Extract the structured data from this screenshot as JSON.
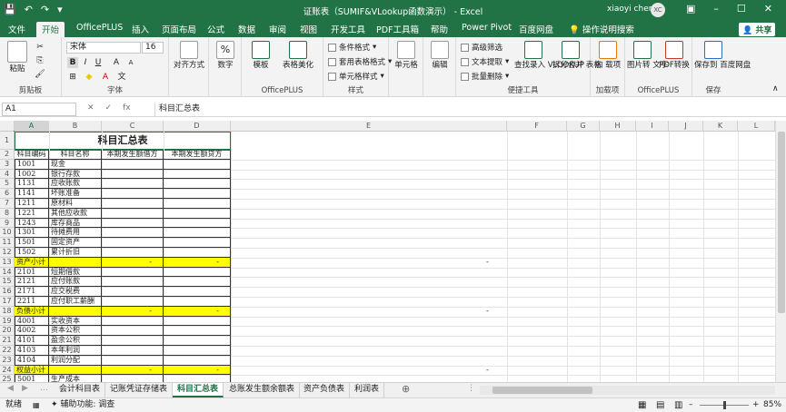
{
  "window": {
    "title": "证账表（SUMIF&VLookup函数演示） - Excel",
    "user": "xiaoyi chen",
    "avatar": "XC"
  },
  "ribbon_tabs": [
    "文件",
    "开始",
    "OfficePLUS",
    "插入",
    "页面布局",
    "公式",
    "数据",
    "审阅",
    "视图",
    "开发工具",
    "PDF工具箱",
    "帮助",
    "Power Pivot",
    "百度网盘",
    "操作说明搜索"
  ],
  "share_label": "共享",
  "ribbon": {
    "clipboard": {
      "paste": "粘贴",
      "group": "剪贴板"
    },
    "font": {
      "name": "宋体",
      "size": "16",
      "bold": "B",
      "italic": "I",
      "underline": "U",
      "group": "字体"
    },
    "align": {
      "label": "对齐方式"
    },
    "number": {
      "label": "数字",
      "percent": "%"
    },
    "officeplus1": {
      "template": "模板",
      "beautify": "表格美化",
      "group": "OfficePLUS"
    },
    "styles": {
      "cond": "条件格式",
      "table": "套用表格格式",
      "cell": "单元格样式",
      "group": "样式"
    },
    "cells": {
      "label": "单元格"
    },
    "edit": {
      "label": "编辑"
    },
    "quick": {
      "filter": "高级筛选",
      "text": "文本提取",
      "batch": "批量删除",
      "lookup": "查找录入 VLOOKUP",
      "split": "拆分合并 表格",
      "group": "便捷工具"
    },
    "load": {
      "label": "加 载项",
      "group": "加载项"
    },
    "officeplus2": {
      "img": "图片转 文字",
      "pdf": "PDF转换",
      "group": "OfficePLUS"
    },
    "save": {
      "label": "保存到 百度网盘",
      "group": "保存"
    }
  },
  "formula": {
    "namebox": "A1",
    "fx": "fx",
    "value": "科目汇总表"
  },
  "columns": [
    "A",
    "B",
    "C",
    "D",
    "E",
    "F",
    "G",
    "H",
    "I",
    "J",
    "K",
    "L"
  ],
  "sheet": {
    "title": "科目汇总表",
    "headers": [
      "科目编码",
      "科目名称",
      "本期发生额借方",
      "本期发生额贷方"
    ],
    "rows": [
      {
        "n": "3",
        "code": "1001",
        "name": "现金"
      },
      {
        "n": "4",
        "code": "1002",
        "name": "银行存款"
      },
      {
        "n": "5",
        "code": "1131",
        "name": "应收账款"
      },
      {
        "n": "6",
        "code": "1141",
        "name": "坏账准备"
      },
      {
        "n": "7",
        "code": "1211",
        "name": "原材料"
      },
      {
        "n": "8",
        "code": "1221",
        "name": "其他应收款"
      },
      {
        "n": "9",
        "code": "1243",
        "name": "库存商品"
      },
      {
        "n": "10",
        "code": "1301",
        "name": "待摊费用"
      },
      {
        "n": "11",
        "code": "1501",
        "name": "固定资产"
      },
      {
        "n": "12",
        "code": "1502",
        "name": "累计折旧"
      },
      {
        "n": "13",
        "code": "资产小计",
        "name": "",
        "c": "-",
        "d": "-",
        "e": "-",
        "sub": true
      },
      {
        "n": "14",
        "code": "2101",
        "name": "短期借款"
      },
      {
        "n": "15",
        "code": "2121",
        "name": "应付账款"
      },
      {
        "n": "16",
        "code": "2171",
        "name": "应交税费"
      },
      {
        "n": "17",
        "code": "2211",
        "name": "应付职工薪酬"
      },
      {
        "n": "18",
        "code": "负债小计",
        "name": "",
        "c": "-",
        "d": "-",
        "e": "-",
        "sub": true
      },
      {
        "n": "19",
        "code": "4001",
        "name": "实收资本"
      },
      {
        "n": "20",
        "code": "4002",
        "name": "资本公积"
      },
      {
        "n": "21",
        "code": "4101",
        "name": "盈余公积"
      },
      {
        "n": "22",
        "code": "4103",
        "name": "本年利润"
      },
      {
        "n": "23",
        "code": "4104",
        "name": "利润分配"
      },
      {
        "n": "24",
        "code": "权益小计",
        "name": "",
        "c": "-",
        "d": "-",
        "e": "-",
        "sub": true
      },
      {
        "n": "25",
        "code": "5001",
        "name": "生产成本"
      }
    ]
  },
  "sheet_tabs": [
    "会计科目表",
    "记账凭证存储表",
    "科目汇总表",
    "总账发生额余额表",
    "资产负债表",
    "利润表"
  ],
  "active_sheet": "科目汇总表",
  "status": {
    "ready": "就绪",
    "accessibility": "辅助功能: 调查",
    "zoom": "85%"
  },
  "colors": {
    "accent": "#217346",
    "subtotal": "#ffff00"
  }
}
